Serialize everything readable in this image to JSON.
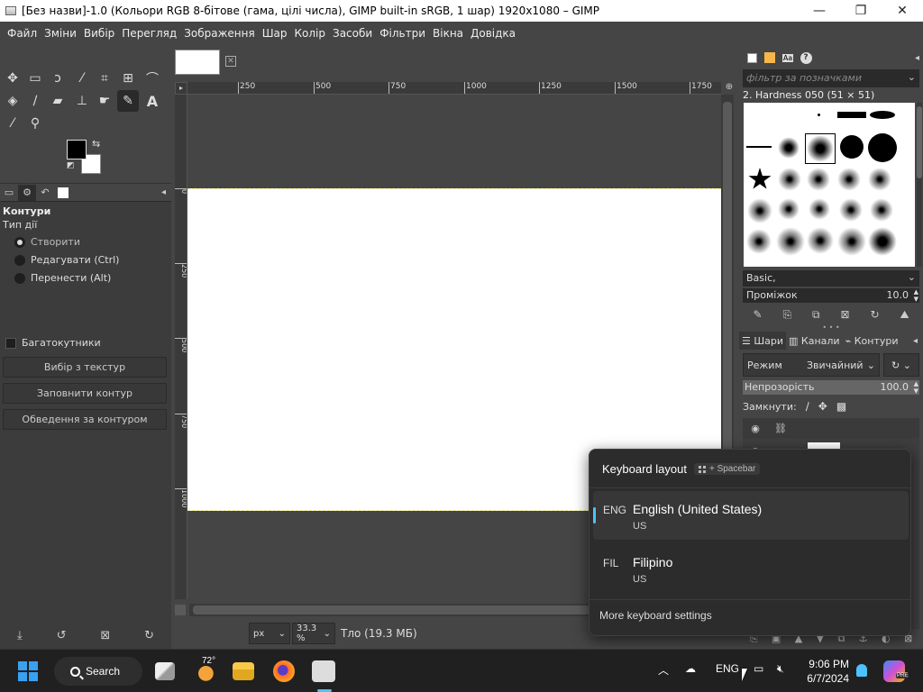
{
  "window": {
    "title": "[Без назви]-1.0 (Кольори RGB 8-бітове (гама, цілі числа), GIMP built-in sRGB, 1 шар) 1920x1080 – GIMP",
    "minimize": "—",
    "maximize": "❐",
    "close": "✕"
  },
  "menubar": [
    "Файл",
    "Зміни",
    "Вибір",
    "Перегляд",
    "Зображення",
    "Шар",
    "Колір",
    "Засоби",
    "Фільтри",
    "Вікна",
    "Довідка"
  ],
  "tool_options": {
    "heading": "Контури",
    "mode_label": "Тип дії",
    "modes": [
      "Створити",
      "Редагувати (Ctrl)",
      "Перенести (Alt)"
    ],
    "selected_mode": "Створити",
    "polygonal_label": "Багатокутники",
    "polygonal_checked": false,
    "buttons": [
      "Вибір з текстур",
      "Заповнити контур",
      "Обведення за контуром"
    ]
  },
  "canvas": {
    "hruler_ticks": [
      "250",
      "500",
      "750",
      "1000",
      "1250",
      "1500",
      "1750"
    ],
    "vruler_ticks": [
      "0",
      "2|5|0",
      "5|0|0",
      "7|5|0",
      "1|0|0|0"
    ]
  },
  "statusbar": {
    "unit": "px",
    "zoom": "33.3 %",
    "info": "Тло (19.3 МБ)"
  },
  "brushes": {
    "filter_placeholder": "фільтр за позначками",
    "selected_brush": "2. Hardness 050 (51 × 51)",
    "tag": "Basic,",
    "spacing_label": "Проміжок",
    "spacing_value": "10.0"
  },
  "layers": {
    "tabs": [
      "Шари",
      "Канали",
      "Контури"
    ],
    "mode_label": "Режим",
    "mode_value": "Звичайний",
    "opacity_label": "Непрозорість",
    "opacity_value": "100.0",
    "lock_label": "Замкнути:"
  },
  "keyboard_flyout": {
    "title": "Keyboard layout",
    "shortcut": "+ Spacebar",
    "items": [
      {
        "code": "ENG",
        "name": "English (United States)",
        "sub": "US",
        "selected": true
      },
      {
        "code": "FIL",
        "name": "Filipino",
        "sub": "US",
        "selected": false
      }
    ],
    "more": "More keyboard settings"
  },
  "taskbar": {
    "search": "Search",
    "weather_temp": "72°",
    "lang": "ENG",
    "time": "9:06 PM",
    "date": "6/7/2024",
    "copilot_badge": "PRE"
  }
}
